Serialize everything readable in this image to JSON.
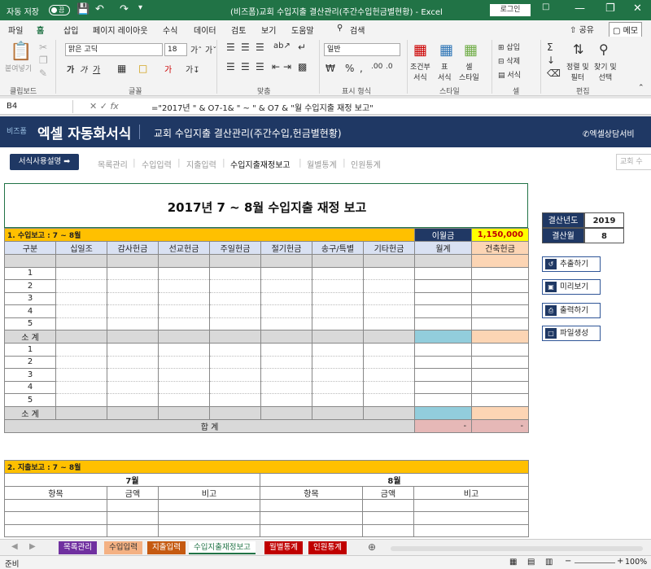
{
  "titlebar": {
    "autosave_label": "자동 저장",
    "autosave_state": "끔",
    "title": "(비즈폼)교회 수입지출 결산관리(주간수입헌금별현황) - Excel",
    "login": "로그인"
  },
  "tabs": [
    "파일",
    "홈",
    "삽입",
    "페이지 레이아웃",
    "수식",
    "데이터",
    "검토",
    "보기",
    "도움말"
  ],
  "active_tab": "홈",
  "search_label": "검색",
  "share_label": "공유",
  "memo_label": "메모",
  "ribbon": {
    "paste": "붙여넣기",
    "font_name": "맑은 고딕",
    "font_size": "18",
    "number_format": "일반",
    "conditional": "조건부\n서식",
    "table": "표\n서식",
    "cell_style": "셀\n스타일",
    "insert": "삽입",
    "delete": "삭제",
    "format": "서식",
    "sort": "정렬 및\n필터",
    "find": "찾기 및\n선택",
    "groups": [
      "클립보드",
      "글꼴",
      "맞춤",
      "표시 형식",
      "스타일",
      "셀",
      "편집"
    ]
  },
  "formula_bar": {
    "name_box": "B4",
    "formula": "=\"2017년 \" & O7-1&  \" ~ \" & O7 & \"월 수입지출 재정 보고\""
  },
  "banner": {
    "brand_small": "비즈폼",
    "brand": "엑셀 자동화서식",
    "title": "교회 수입지출 결산관리(주간수입,헌금별현황)",
    "right": "엑셀상담서비"
  },
  "guide_button": "서식사용설명",
  "nav": [
    "목록관리",
    "수입입력",
    "지출입력",
    "수입지출재정보고",
    "월별통계",
    "인원통계"
  ],
  "nav_current": "수입지출재정보고",
  "search_placeholder": "교회 수",
  "report": {
    "title": "2017년 7 ~ 8월 수입지출 재정 보고",
    "section1": "1. 수입보고 : 7 ~ 8월",
    "carryover_label": "이월금",
    "carryover_value": "1,150,000",
    "headers": [
      "구분",
      "십일조",
      "감사헌금",
      "선교헌금",
      "주일헌금",
      "절기헌금",
      "송구/특별",
      "기타헌금",
      "월계",
      "건축헌금"
    ],
    "rows_a": [
      "1",
      "2",
      "3",
      "4",
      "5"
    ],
    "subtotal": "소  계",
    "rows_b": [
      "1",
      "2",
      "3",
      "4",
      "5"
    ],
    "total_label": "합  계",
    "total_monthly": "-",
    "total_building": "-",
    "section2": "2. 지출보고 : 7 ~ 8월",
    "month1": "7월",
    "month2": "8월",
    "exp_headers": [
      "항목",
      "금액",
      "비고"
    ]
  },
  "side": {
    "year_label": "결산년도",
    "year_value": "2019",
    "month_label": "결산월",
    "month_value": "8",
    "buttons": [
      "추출하기",
      "미리보기",
      "출력하기",
      "파일생성"
    ]
  },
  "sheet_tabs": [
    {
      "label": "목록관리",
      "color": "#7030a0"
    },
    {
      "label": "수입입력",
      "color": "#f4b183"
    },
    {
      "label": "지출입력",
      "color": "#c55a11"
    },
    {
      "label": "수입지출재정보고",
      "color": "#ffffff"
    },
    {
      "label": "월별통계",
      "color": "#c00000"
    },
    {
      "label": "인원통계",
      "color": "#c00000"
    }
  ],
  "status": {
    "ready": "준비",
    "zoom": "100%"
  }
}
